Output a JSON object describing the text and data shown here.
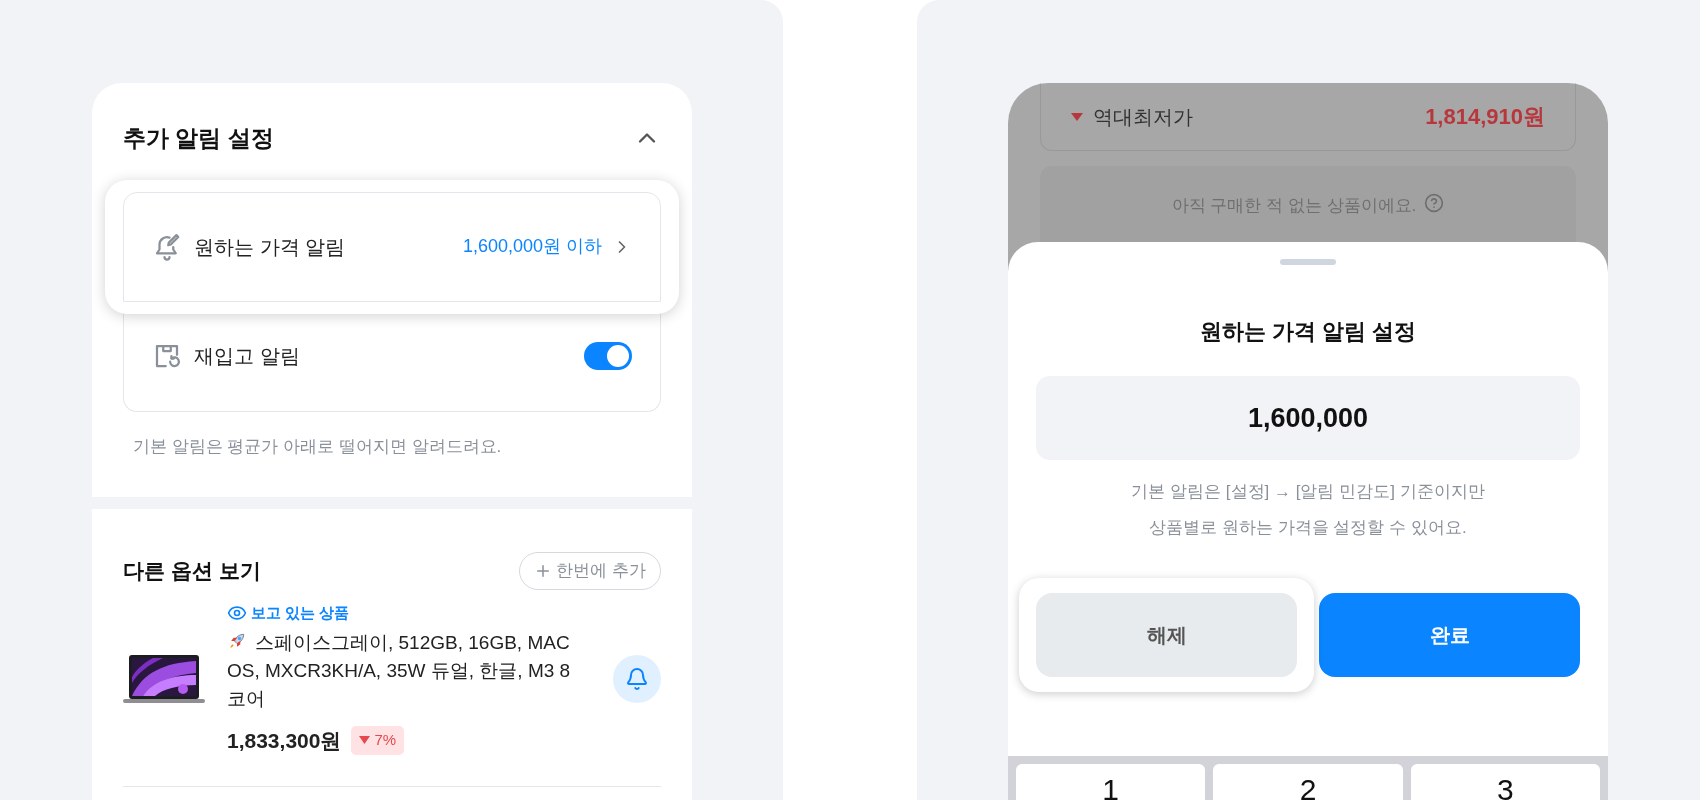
{
  "alert_settings": {
    "title": "추가 알림 설정",
    "expanded": true,
    "rows": [
      {
        "kind": "link",
        "label": "원하는 가격 알림",
        "value": "1,600,000원 이하",
        "highlighted": true
      },
      {
        "kind": "toggle",
        "label": "재입고 알림",
        "on": true,
        "highlighted": false
      }
    ],
    "note": "기본 알림은 평균가 아래로 떨어지면 알려드려요."
  },
  "other_options": {
    "title": "다른 옵션 보기",
    "add_button": "한번에 추가",
    "product": {
      "badge": "보고 있는 상품",
      "name": "스페이스그레이, 512GB, 16GB, MAC OS, MXCR3KH/A, 35W 듀얼, 한글, M3 8코어",
      "price": "1,833,300원",
      "discount": "7%",
      "alert_on": true
    }
  },
  "background": {
    "lowest_label": "역대최저가",
    "lowest_price": "1,814,910원",
    "purchase_note": "아직 구매한 적 없는 상품이에요."
  },
  "sheet": {
    "title": "원하는 가격 알림 설정",
    "value": "1,600,000",
    "help": [
      "기본 알림은 [설정] → [알림 민감도] 기준이지만",
      "상품별로 원하는 가격을 설정할 수 있어요."
    ],
    "buttons": [
      {
        "kind": "secondary",
        "label": "해제",
        "highlighted": true
      },
      {
        "kind": "primary",
        "label": "완료",
        "highlighted": false
      }
    ]
  },
  "keypad": [
    "1",
    "2",
    "3"
  ]
}
